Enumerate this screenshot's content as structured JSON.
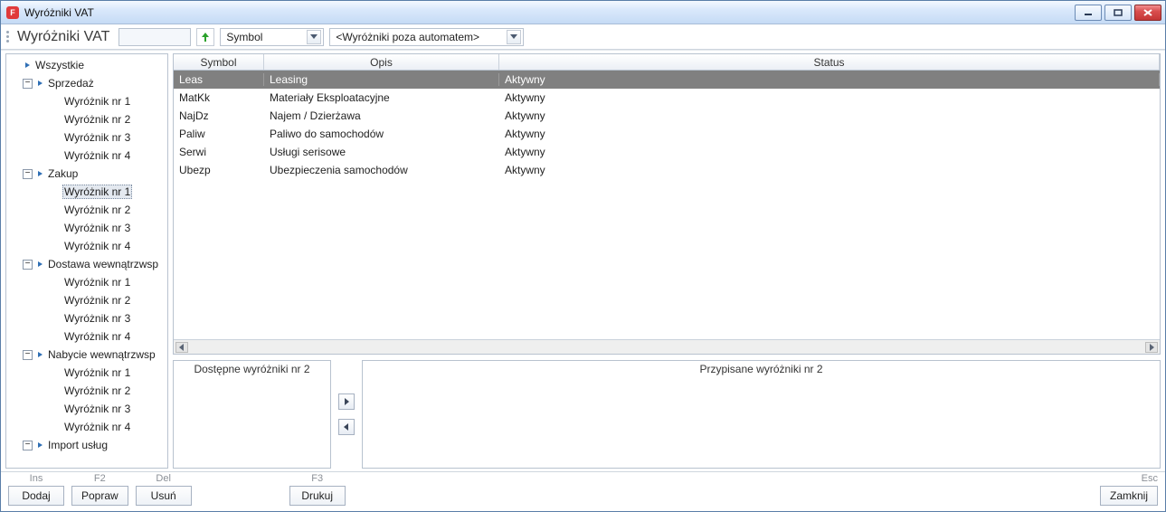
{
  "window": {
    "title": "Wyróżniki VAT"
  },
  "toolbar": {
    "heading": "Wyróżniki VAT",
    "sort_field": "Symbol",
    "filter": "<Wyróżniki poza automatem>"
  },
  "tree": {
    "root": "Wszystkie",
    "groups": [
      {
        "label": "Sprzedaż",
        "items": [
          "Wyróżnik nr 1",
          "Wyróżnik nr 2",
          "Wyróżnik nr 3",
          "Wyróżnik nr 4"
        ]
      },
      {
        "label": "Zakup",
        "items": [
          "Wyróżnik nr 1",
          "Wyróżnik nr 2",
          "Wyróżnik nr 3",
          "Wyróżnik nr 4"
        ],
        "selectedIndex": 0
      },
      {
        "label": "Dostawa wewnątrzwsp",
        "items": [
          "Wyróżnik nr 1",
          "Wyróżnik nr 2",
          "Wyróżnik nr 3",
          "Wyróżnik nr 4"
        ]
      },
      {
        "label": "Nabycie wewnątrzwsp",
        "items": [
          "Wyróżnik nr 1",
          "Wyróżnik nr 2",
          "Wyróżnik nr 3",
          "Wyróżnik nr 4"
        ]
      },
      {
        "label": "Import usług",
        "items": []
      }
    ]
  },
  "grid": {
    "columns": {
      "symbol": "Symbol",
      "opis": "Opis",
      "status": "Status"
    },
    "rows": [
      {
        "symbol": "Leas",
        "opis": "Leasing",
        "status": "Aktywny",
        "selected": true
      },
      {
        "symbol": "MatKk",
        "opis": "Materiały Eksploatacyjne",
        "status": "Aktywny"
      },
      {
        "symbol": "NajDz",
        "opis": "Najem / Dzierżawa",
        "status": "Aktywny"
      },
      {
        "symbol": "Paliw",
        "opis": "Paliwo do samochodów",
        "status": "Aktywny"
      },
      {
        "symbol": "Serwi",
        "opis": "Usługi serisowe",
        "status": "Aktywny"
      },
      {
        "symbol": "Ubezp",
        "opis": "Ubezpieczenia samochodów",
        "status": "Aktywny"
      }
    ]
  },
  "assign": {
    "available_title": "Dostępne wyróżniki nr 2",
    "assigned_title": "Przypisane wyróżniki nr 2"
  },
  "buttons": {
    "ins": "Ins",
    "add": "Dodaj",
    "f2": "F2",
    "edit": "Popraw",
    "del": "Del",
    "delete": "Usuń",
    "f3": "F3",
    "print": "Drukuj",
    "esc": "Esc",
    "close": "Zamknij"
  }
}
